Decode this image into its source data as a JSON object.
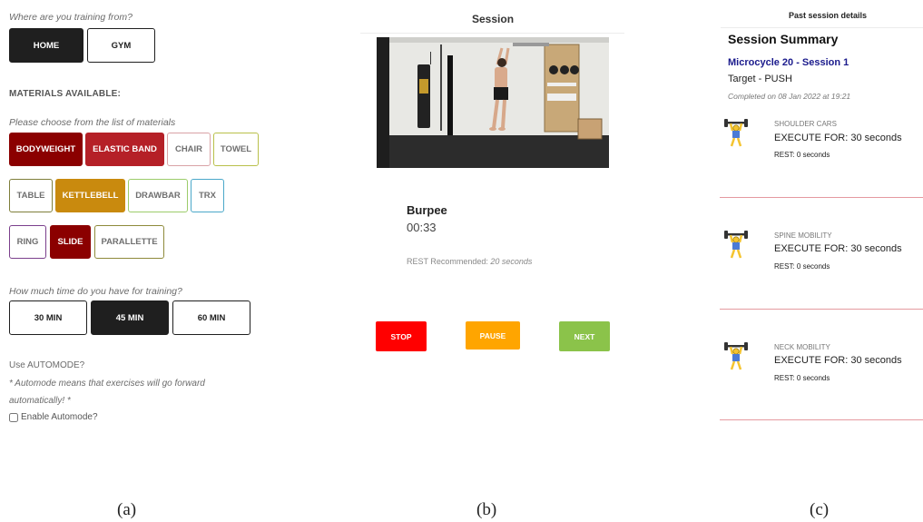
{
  "panel_a": {
    "location_question": "Where are you training from?",
    "locations": [
      {
        "label": "HOME",
        "selected": true
      },
      {
        "label": "GYM",
        "selected": false
      }
    ],
    "materials_title": "MATERIALS AVAILABLE:",
    "materials_prompt": "Please choose from the list of materials",
    "materials": [
      {
        "label": "BODYWEIGHT",
        "selected": true,
        "color": "#8b0000"
      },
      {
        "label": "ELASTIC BAND",
        "selected": true,
        "color": "#b52027"
      },
      {
        "label": "CHAIR",
        "selected": false,
        "color": "#d9a2a6"
      },
      {
        "label": "TOWEL",
        "selected": false,
        "color": "#b9c04a"
      },
      {
        "label": "TABLE",
        "selected": false,
        "color": "#7e7e3a"
      },
      {
        "label": "KETTLEBELL",
        "selected": true,
        "color": "#c98a0e"
      },
      {
        "label": "DRAWBAR",
        "selected": false,
        "color": "#9ccc6a"
      },
      {
        "label": "TRX",
        "selected": false,
        "color": "#4aa8c9"
      },
      {
        "label": "RING",
        "selected": false,
        "color": "#7b3f8c"
      },
      {
        "label": "SLIDE",
        "selected": true,
        "color": "#8b0000"
      },
      {
        "label": "PARALLETTE",
        "selected": false,
        "color": "#8e8a3a"
      }
    ],
    "time_question": "How much time do you have for training?",
    "times": [
      {
        "label": "30 MIN",
        "selected": false
      },
      {
        "label": "45 MIN",
        "selected": true
      },
      {
        "label": "60 MIN",
        "selected": false
      }
    ],
    "automode_title": "Use AUTOMODE?",
    "automode_note_line1": "* Automode means that exercises will go forward",
    "automode_note_line2": "automatically! *",
    "automode_checkbox_label": "Enable Automode?",
    "automode_enabled": false
  },
  "panel_b": {
    "header": "Session",
    "exercise_name": "Burpee",
    "timer": "00:33",
    "rest_label": "REST Recommended:",
    "rest_value": "20 seconds",
    "controls": [
      {
        "label": "STOP",
        "color": "#ff0000"
      },
      {
        "label": "PAUSE",
        "color": "#ffa500"
      },
      {
        "label": "NEXT",
        "color": "#8bc34a"
      }
    ]
  },
  "panel_c": {
    "header": "Past session details",
    "title": "Session Summary",
    "microcycle": "Microcycle 20 - Session 1",
    "target": "Target - PUSH",
    "completed": "Completed on 08 Jan 2022 at 19:21",
    "exercises": [
      {
        "name": "SHOULDER CARS",
        "execute": "EXECUTE FOR: 30 seconds",
        "rest": "REST: 0 seconds",
        "icon": "weightlifter-icon"
      },
      {
        "name": "SPINE MOBILITY",
        "execute": "EXECUTE FOR: 30 seconds",
        "rest": "REST: 0 seconds",
        "icon": "weightlifter-icon"
      },
      {
        "name": "NECK MOBILITY",
        "execute": "EXECUTE FOR: 30 seconds",
        "rest": "REST: 0 seconds",
        "icon": "weightlifter-icon"
      }
    ]
  },
  "captions": [
    "(a)",
    "(b)",
    "(c)"
  ]
}
